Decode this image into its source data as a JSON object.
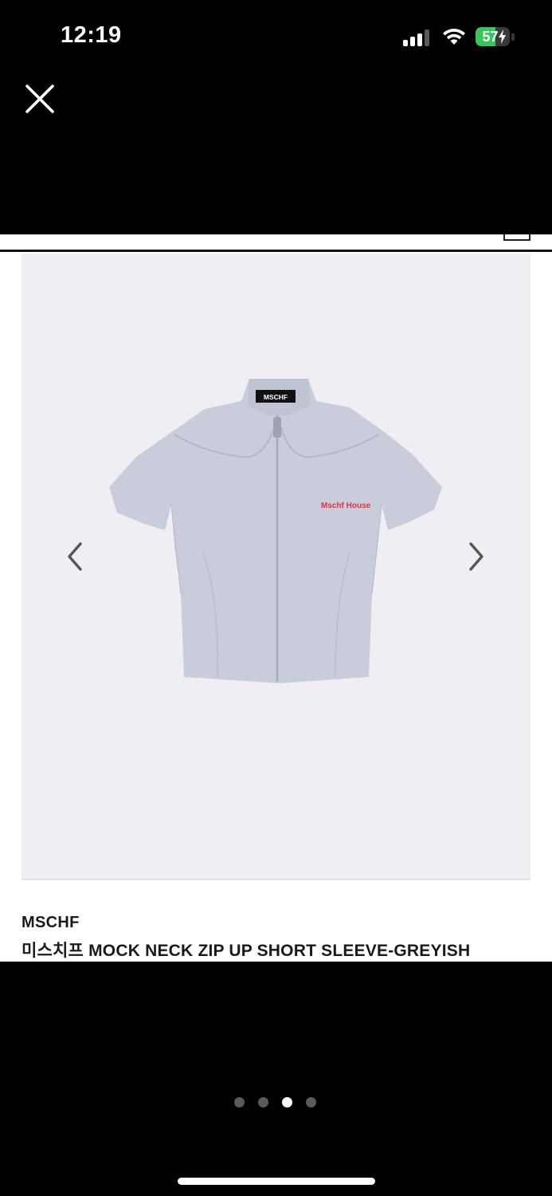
{
  "status_bar": {
    "time": "12:19",
    "battery_level": "57",
    "battery_fill_fraction": 0.57,
    "signal_bars_active": 3,
    "signal_bars_total": 4
  },
  "viewer": {
    "close_icon": "close-icon",
    "page_count": 4,
    "current_page": 3
  },
  "product": {
    "brand": "MSCHF",
    "title": "미스치프 MOCK NECK ZIP UP SHORT SLEEVE-GREYISH",
    "image": {
      "neck_label": "MSCHF",
      "chest_print": "Mschf House",
      "background_color": "#efeff3",
      "shirt_color": "#c9ccdb",
      "print_color": "#e0323c"
    },
    "prev_icon": "chevron-left-icon",
    "next_icon": "chevron-right-icon"
  },
  "colors": {
    "background": "#000000",
    "battery_green": "#34c759",
    "dot_active": "#ffffff",
    "dot_inactive": "#5a5a5a"
  }
}
